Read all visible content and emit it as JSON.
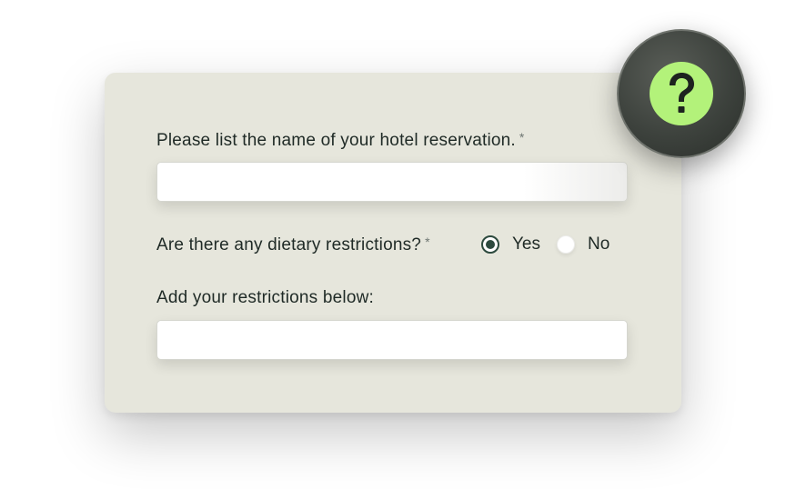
{
  "form": {
    "question_hotel": "Please list the name of your hotel reservation.",
    "question_hotel_required": "*",
    "hotel_input_value": "",
    "question_dietary": "Are there any dietary restrictions?",
    "question_dietary_required": "*",
    "dietary_options": [
      {
        "label": "Yes",
        "selected": true
      },
      {
        "label": "No",
        "selected": false
      }
    ],
    "restrictions_label": "Add your restrictions below:",
    "restrictions_input_value": ""
  },
  "help_badge": {
    "icon": "question-mark-icon",
    "accent_color": "#b3f27a",
    "badge_color": "#3d423d"
  },
  "colors": {
    "card_bg": "#e6e6dc",
    "text": "#1f2a26",
    "radio_selected": "#2d4a3e"
  }
}
